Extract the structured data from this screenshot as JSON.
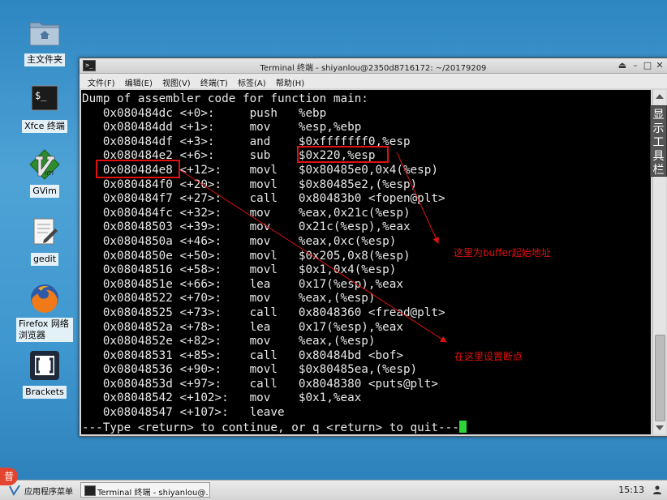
{
  "desktop": {
    "icons": [
      {
        "label": "主文件夹"
      },
      {
        "label": "Xfce 终端"
      },
      {
        "label": "GVim"
      },
      {
        "label": "gedit"
      },
      {
        "label": "Firefox 网络浏览器"
      },
      {
        "label": "Brackets"
      }
    ]
  },
  "window": {
    "title": "Terminal 终端 - shiyanlou@2350d8716172: ~/20179209",
    "menu": [
      "文件(F)",
      "编辑(E)",
      "视图(V)",
      "终端(T)",
      "标签(A)",
      "帮助(H)"
    ]
  },
  "terminal": {
    "lines": [
      "Dump of assembler code for function main:",
      "   0x080484dc <+0>:     push   %ebp",
      "   0x080484dd <+1>:     mov    %esp,%ebp",
      "   0x080484df <+3>:     and    $0xfffffff0,%esp",
      "   0x080484e2 <+6>:     sub    $0x220,%esp",
      "   0x080484e8 <+12>:    movl   $0x80485e0,0x4(%esp)",
      "   0x080484f0 <+20>:    movl   $0x80485e2,(%esp)",
      "   0x080484f7 <+27>:    call   0x80483b0 <fopen@plt>",
      "   0x080484fc <+32>:    mov    %eax,0x21c(%esp)",
      "   0x08048503 <+39>:    mov    0x21c(%esp),%eax",
      "   0x0804850a <+46>:    mov    %eax,0xc(%esp)",
      "   0x0804850e <+50>:    movl   $0x205,0x8(%esp)",
      "   0x08048516 <+58>:    movl   $0x1,0x4(%esp)",
      "   0x0804851e <+66>:    lea    0x17(%esp),%eax",
      "   0x08048522 <+70>:    mov    %eax,(%esp)",
      "   0x08048525 <+73>:    call   0x8048360 <fread@plt>",
      "   0x0804852a <+78>:    lea    0x17(%esp),%eax",
      "   0x0804852e <+82>:    mov    %eax,(%esp)",
      "   0x08048531 <+85>:    call   0x80484bd <bof>",
      "   0x08048536 <+90>:    movl   $0x80485ea,(%esp)",
      "   0x0804853d <+97>:    call   0x8048380 <puts@plt>",
      "   0x08048542 <+102>:   mov    $0x1,%eax",
      "   0x08048547 <+107>:   leave"
    ],
    "prompt": "---Type <return> to continue, or q <return> to quit---"
  },
  "side_tab": {
    "label": "显示工具栏"
  },
  "annotations": {
    "buffer_note": "这里为buffer起始地址",
    "breakpoint_note": "在这里设置断点",
    "color": "#e01010"
  },
  "taskbar": {
    "notification_glyph": "昔",
    "start_label": "应用程序菜单",
    "task_label": "Terminal 终端 - shiyanlou@…",
    "clock": "15:13"
  },
  "colors": {
    "desktop": "#3b8fc6",
    "terminal_bg": "#000000",
    "terminal_fg": "#e8e8e8",
    "cursor": "#2fd33a"
  }
}
